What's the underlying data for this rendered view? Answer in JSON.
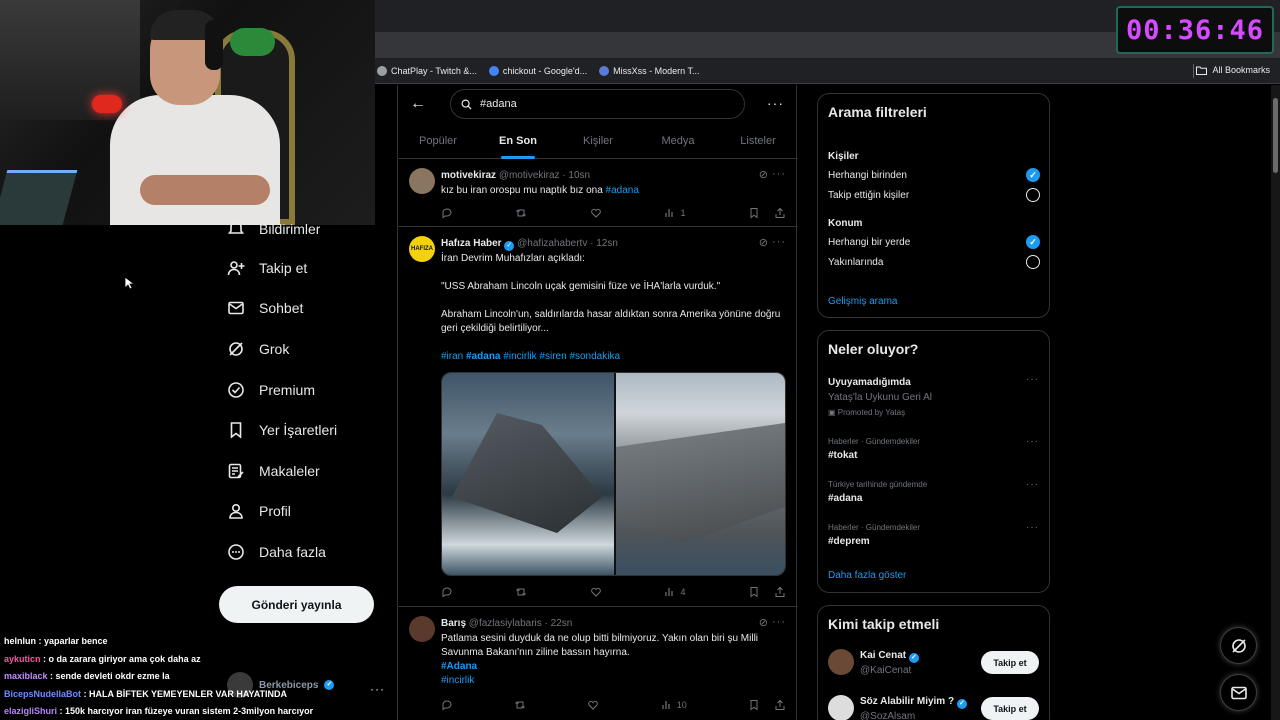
{
  "bookmarks": [
    "ChatPlay - Twitch &...",
    "chickout - Google'd...",
    "MissXss - Modern T..."
  ],
  "bookmarks_all": "All Bookmarks",
  "timer": "00:36:46",
  "nav": {
    "partial_top": "Bildirimler",
    "items": [
      "Takip et",
      "Sohbet",
      "Grok",
      "Premium",
      "Yer İşaretleri",
      "Makaleler",
      "Profil",
      "Daha fazla"
    ],
    "post_button": "Gönderi yayınla",
    "account_name": "Berkebiceps"
  },
  "chat": [
    {
      "user": "helnlun",
      "color": "#ffffff",
      "text": ": yaparlar bence"
    },
    {
      "user": "aykuticn",
      "color": "#ff4fa3",
      "text": ": o da zarara giriyor ama çok daha az"
    },
    {
      "user": "maxiblack",
      "color": "#c38cff",
      "text": ": sende devleti okdr ezme la"
    },
    {
      "user": "BicepsNudellaBot",
      "color": "#6f8cff",
      "text": ": HALA BİFTEK YEMEYENLER VAR HAYATINDA"
    },
    {
      "user": "elazigliShuri",
      "color": "#b483ff",
      "text": ": 150k harcıyor iran füzeye vuran sistem 2-3milyon harcıyor"
    }
  ],
  "search": {
    "query": "#adana"
  },
  "tabs": [
    "Popüler",
    "En Son",
    "Kişiler",
    "Medya",
    "Listeler"
  ],
  "tweets": [
    {
      "name": "motivekiraz",
      "handle": "@motivekiraz",
      "time": "· 10sn",
      "text": "kız bu iran orospu mu naptık bız ona",
      "tag": "#adana",
      "views": "1"
    },
    {
      "name": "Hafıza Haber",
      "handle": "@hafizahabertv",
      "time": "· 12sn",
      "line1": "İran Devrim Muhafızları açıkladı:",
      "line2": "\"USS Abraham Lincoln uçak gemisini füze ve İHA'larla vurduk.\"",
      "line3": "Abraham Lincoln'un, saldırılarda hasar aldıktan sonra Amerika yönüne doğru geri çekildiği belirtiliyor...",
      "tags": [
        "#iran",
        "#adana",
        "#incirlik",
        "#siren",
        "#sondakika"
      ],
      "views": "4",
      "avatar_text": "HAFIZA"
    },
    {
      "name": "Barış",
      "handle": "@fazlasiylabaris",
      "time": "· 22sn",
      "text": "Patlama sesini duyduk da ne olup bitti bilmiyoruz. Yakın olan biri şu Milli Savunma Bakanı'nın ziline bassın hayırna.",
      "tags": [
        "#Adana",
        "#incirlik"
      ],
      "views": "10"
    }
  ],
  "filters": {
    "title": "Arama filtreleri",
    "people_title": "Kişiler",
    "people_options": [
      "Herhangi birinden",
      "Takip ettiğin kişiler"
    ],
    "location_title": "Konum",
    "location_options": [
      "Herhangi bir yerde",
      "Yakınlarında"
    ],
    "advanced": "Gelişmiş arama"
  },
  "trends": {
    "title": "Neler oluyor?",
    "promo": {
      "name": "Uyuyamadığımda",
      "desc": "Yataş'la Uykunu Geri Al",
      "promoted": "Promoted by Yataş"
    },
    "items": [
      {
        "meta": "Haberler · Gündemdekiler",
        "name": "#tokat"
      },
      {
        "meta": "Türkiye tarihinde gündemde",
        "name": "#adana"
      },
      {
        "meta": "Haberler · Gündemdekiler",
        "name": "#deprem"
      }
    ],
    "more": "Daha fazla göster"
  },
  "who_to_follow": {
    "title": "Kimi takip etmeli",
    "accounts": [
      {
        "name": "Kai Cenat",
        "handle": "@KaiCenat",
        "button": "Takip et"
      },
      {
        "name": "Söz Alabilir Miyim ?",
        "handle": "@SozAlsam",
        "button": "Takip et"
      }
    ]
  },
  "colors": {
    "accent": "#1d9bf0",
    "timer": "#d64bff",
    "background": "#000000"
  }
}
